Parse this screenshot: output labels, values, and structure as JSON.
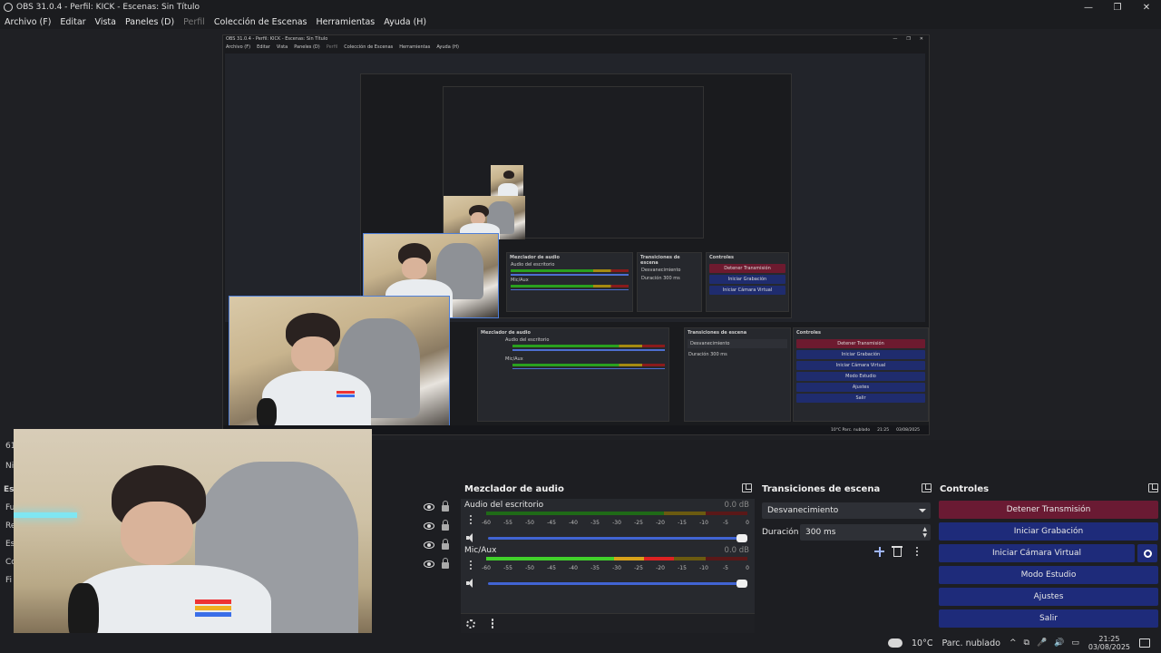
{
  "window": {
    "title": "OBS 31.0.4 - Perfil: KICK - Escenas: Sin Título",
    "controls": [
      "—",
      "❐",
      "✕"
    ]
  },
  "menu": [
    {
      "label": "Archivo (F)",
      "disabled": false
    },
    {
      "label": "Editar",
      "disabled": false
    },
    {
      "label": "Vista",
      "disabled": false
    },
    {
      "label": "Paneles (D)",
      "disabled": false
    },
    {
      "label": "Perfil",
      "disabled": true
    },
    {
      "label": "Colección de Escenas",
      "disabled": false
    },
    {
      "label": "Herramientas",
      "disabled": false
    },
    {
      "label": "Ayuda (H)",
      "disabled": false
    }
  ],
  "nested": {
    "title": "OBS 31.0.4 - Perfil: KICK - Escenas: Sin Título",
    "menu": [
      "Archivo (F)",
      "Editar",
      "Vista",
      "Paneles (D)",
      "Perfil",
      "Colección de Escenas",
      "Herramientas",
      "Ayuda (H)"
    ],
    "mixer_title": "Mezclador de audio",
    "transitions_title": "Transiciones de escena",
    "controls_title": "Controles",
    "desktop_audio": "Audio del escritorio",
    "mic": "Mic/Aux",
    "db": "0.0 dB",
    "fade": "Desvanecimiento",
    "duration_label": "Duración",
    "duration_value": "300 ms",
    "buttons": [
      "Detener Transmisión",
      "Iniciar Grabación",
      "Iniciar Cámara Virtual",
      "Modo Estudio",
      "Ajustes",
      "Salir"
    ],
    "taskbar_weather": "10°C  Parc. nublado",
    "taskbar_time": "21:25",
    "taskbar_date": "03/08/2025"
  },
  "left_hidden": [
    "61",
    "Ni",
    "Es",
    "Fu",
    "Re",
    "Es",
    "Co",
    "Fi"
  ],
  "mixer": {
    "title": "Mezclador de audio",
    "ticks": [
      "-60",
      "-55",
      "-50",
      "-45",
      "-40",
      "-35",
      "-30",
      "-25",
      "-20",
      "-15",
      "-10",
      "-5",
      "0"
    ],
    "channels": [
      {
        "name": "Audio del escritorio",
        "db": "0.0 dB",
        "level": 0.0
      },
      {
        "name": "Mic/Aux",
        "db": "0.0 dB",
        "level": 0.72
      }
    ]
  },
  "transitions": {
    "title": "Transiciones de escena",
    "selected": "Desvanecimiento",
    "duration_label": "Duración",
    "duration_value": "300 ms"
  },
  "controls": {
    "title": "Controles",
    "stop_stream": "Detener Transmisión",
    "start_recording": "Iniciar Grabación",
    "start_virtual_cam": "Iniciar Cámara Virtual",
    "studio_mode": "Modo Estudio",
    "settings": "Ajustes",
    "exit": "Salir"
  },
  "taskbar": {
    "temperature": "10°C",
    "weather": "Parc. nublado",
    "time": "21:25",
    "date": "03/08/2025",
    "tray": [
      "^",
      "⧉",
      "🎤",
      "🔊",
      "▭"
    ]
  },
  "colors": {
    "accent_blue": "#1e2b7a",
    "stop_red": "#6a1a33",
    "meter_green": "#41d12b",
    "meter_yellow": "#d8a21a",
    "meter_red": "#d22222"
  }
}
